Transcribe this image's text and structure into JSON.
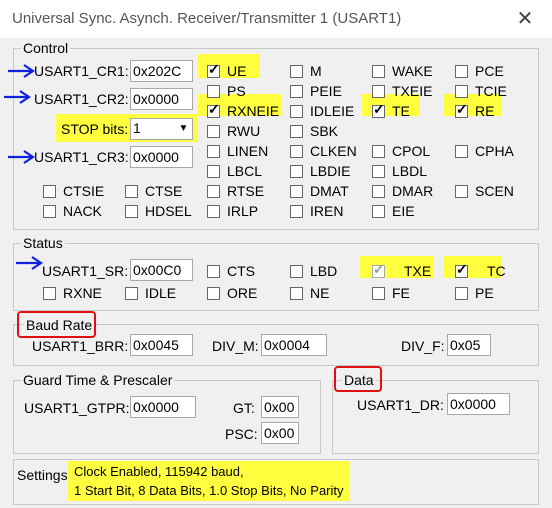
{
  "window": {
    "title": "Universal Sync. Asynch. Receiver/Transmitter 1 (USART1)",
    "close_glyph": "✕"
  },
  "control": {
    "group_label": "Control",
    "cr1": {
      "label": "USART1_CR1:",
      "value": "0x202C"
    },
    "cr2": {
      "label": "USART1_CR2:",
      "value": "0x0000"
    },
    "stop": {
      "label": "STOP bits:",
      "value": "1"
    },
    "cr3": {
      "label": "USART1_CR3:",
      "value": "0x0000"
    },
    "flags": [
      {
        "name": "UE",
        "checked": true
      },
      {
        "name": "M",
        "checked": false
      },
      {
        "name": "WAKE",
        "checked": false
      },
      {
        "name": "PCE",
        "checked": false
      },
      {
        "name": "PS",
        "checked": false
      },
      {
        "name": "PEIE",
        "checked": false
      },
      {
        "name": "TXEIE",
        "checked": false
      },
      {
        "name": "TCIE",
        "checked": false
      },
      {
        "name": "RXNEIE",
        "checked": true
      },
      {
        "name": "IDLEIE",
        "checked": false
      },
      {
        "name": "TE",
        "checked": true
      },
      {
        "name": "RE",
        "checked": true
      },
      {
        "name": "RWU",
        "checked": false
      },
      {
        "name": "SBK",
        "checked": false
      },
      {
        "name": "LINEN",
        "checked": false
      },
      {
        "name": "CLKEN",
        "checked": false
      },
      {
        "name": "CPOL",
        "checked": false
      },
      {
        "name": "CPHA",
        "checked": false
      },
      {
        "name": "LBCL",
        "checked": false
      },
      {
        "name": "LBDIE",
        "checked": false
      },
      {
        "name": "LBDL",
        "checked": false
      },
      {
        "name": "CTSIE",
        "checked": false
      },
      {
        "name": "CTSE",
        "checked": false
      },
      {
        "name": "RTSE",
        "checked": false
      },
      {
        "name": "DMAT",
        "checked": false
      },
      {
        "name": "DMAR",
        "checked": false
      },
      {
        "name": "SCEN",
        "checked": false
      },
      {
        "name": "NACK",
        "checked": false
      },
      {
        "name": "HDSEL",
        "checked": false
      },
      {
        "name": "IRLP",
        "checked": false
      },
      {
        "name": "IREN",
        "checked": false
      },
      {
        "name": "EIE",
        "checked": false
      }
    ]
  },
  "status": {
    "group_label": "Status",
    "sr": {
      "label": "USART1_SR:",
      "value": "0x00C0"
    },
    "flags": [
      {
        "name": "CTS",
        "checked": false
      },
      {
        "name": "LBD",
        "checked": false
      },
      {
        "name": "TXE",
        "checked": true
      },
      {
        "name": "TC",
        "checked": true
      },
      {
        "name": "RXNE",
        "checked": false
      },
      {
        "name": "IDLE",
        "checked": false
      },
      {
        "name": "ORE",
        "checked": false
      },
      {
        "name": "NE",
        "checked": false
      },
      {
        "name": "FE",
        "checked": false
      },
      {
        "name": "PE",
        "checked": false
      }
    ]
  },
  "baud": {
    "group_label": "Baud Rate",
    "brr": {
      "label": "USART1_BRR:",
      "value": "0x0045"
    },
    "div_m": {
      "label": "DIV_M:",
      "value": "0x0004"
    },
    "div_f": {
      "label": "DIV_F:",
      "value": "0x05"
    }
  },
  "guard": {
    "group_label": "Guard Time & Prescaler",
    "gtpr": {
      "label": "USART1_GTPR:",
      "value": "0x0000"
    },
    "gt": {
      "label": "GT:",
      "value": "0x00"
    },
    "psc": {
      "label": "PSC:",
      "value": "0x00"
    }
  },
  "data": {
    "group_label": "Data",
    "dr": {
      "label": "USART1_DR:",
      "value": "0x0000"
    }
  },
  "settings": {
    "label": "Settings:",
    "line1": "Clock Enabled,  115942 baud,",
    "line2": "1 Start Bit, 8 Data Bits, 1.0 Stop Bits, No Parity"
  },
  "annotations": {
    "highlight_color": "#ffff40",
    "arrow_color": "#1020e0",
    "box_color": "#e01010"
  }
}
